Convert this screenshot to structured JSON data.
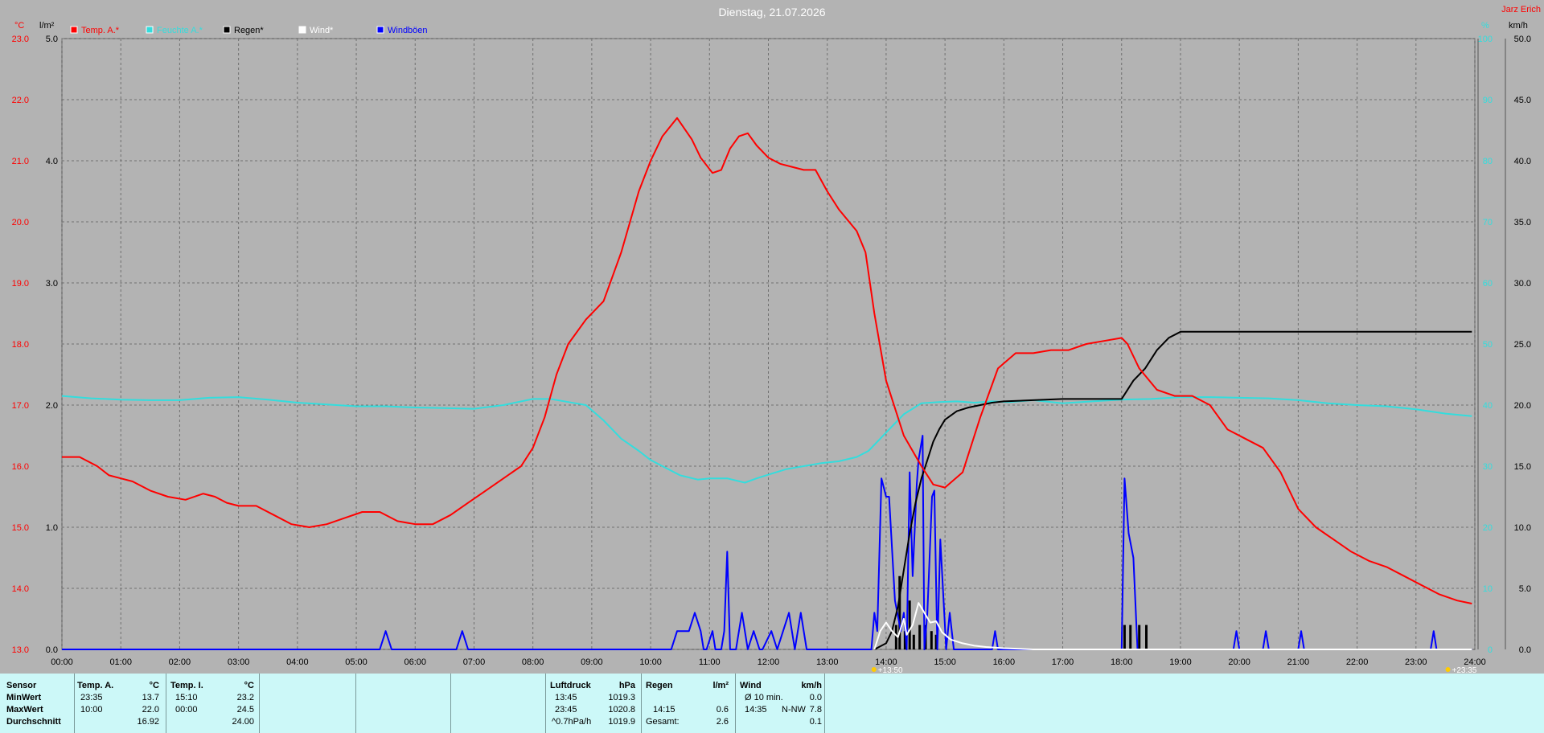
{
  "header": {
    "date": "Dienstag, 21.07.2026",
    "brand": "Jarz Erich"
  },
  "units": {
    "temp": "°C",
    "rain": "l/m²",
    "humidity": "%",
    "wind": "km/h"
  },
  "legend": [
    {
      "label": "Temp. A.*",
      "color": "#ff0000"
    },
    {
      "label": "Feuchte A.*",
      "color": "#33dddd"
    },
    {
      "label": "Regen*",
      "color": "#000000"
    },
    {
      "label": "Wind*",
      "color": "#ffffff"
    },
    {
      "label": "Windböen",
      "color": "#0000ff"
    }
  ],
  "time_markers": {
    "start": "13:50",
    "end": "23:35"
  },
  "chart_data": {
    "type": "line",
    "xlabel": "",
    "x_ticks": [
      "00:00",
      "01:00",
      "02:00",
      "03:00",
      "04:00",
      "05:00",
      "06:00",
      "07:00",
      "08:00",
      "09:00",
      "10:00",
      "11:00",
      "12:00",
      "13:00",
      "14:00",
      "15:00",
      "16:00",
      "17:00",
      "18:00",
      "19:00",
      "20:00",
      "21:00",
      "22:00",
      "23:00",
      "24:00"
    ],
    "xlim": [
      0,
      24
    ],
    "axes": {
      "temp": {
        "ylim": [
          13.0,
          23.0
        ],
        "ticks": [
          "13.0",
          "14.0",
          "15.0",
          "16.0",
          "17.0",
          "18.0",
          "19.0",
          "20.0",
          "21.0",
          "22.0",
          "23.0"
        ],
        "color": "#ff0000"
      },
      "rain": {
        "ylim": [
          0.0,
          5.0
        ],
        "ticks": [
          "0.0",
          "1.0",
          "2.0",
          "3.0",
          "4.0",
          "5.0"
        ],
        "color": "#000000"
      },
      "humidity": {
        "ylim": [
          0,
          100
        ],
        "ticks": [
          "0",
          "10",
          "20",
          "30",
          "40",
          "50",
          "60",
          "70",
          "80",
          "90",
          "100"
        ],
        "color": "#33dddd"
      },
      "wind": {
        "ylim": [
          0.0,
          50.0
        ],
        "ticks": [
          "0.0",
          "5.0",
          "10.0",
          "15.0",
          "20.0",
          "25.0",
          "30.0",
          "35.0",
          "40.0",
          "45.0",
          "50.0"
        ],
        "color": "#000000"
      }
    },
    "grid": true,
    "series": [
      {
        "name": "Temp. A.*",
        "axis": "temp",
        "color": "#ff0000",
        "x": [
          0,
          0.3,
          0.6,
          0.8,
          1.0,
          1.2,
          1.5,
          1.8,
          2.1,
          2.4,
          2.6,
          2.8,
          3.0,
          3.3,
          3.6,
          3.9,
          4.2,
          4.5,
          4.8,
          5.1,
          5.4,
          5.7,
          6.0,
          6.3,
          6.6,
          6.9,
          7.2,
          7.5,
          7.8,
          8.0,
          8.2,
          8.4,
          8.6,
          8.9,
          9.2,
          9.5,
          9.8,
          10.0,
          10.2,
          10.45,
          10.7,
          10.85,
          11.05,
          11.2,
          11.35,
          11.5,
          11.65,
          11.8,
          12.0,
          12.2,
          12.4,
          12.6,
          12.8,
          13.0,
          13.2,
          13.5,
          13.65,
          13.8,
          14.0,
          14.3,
          14.6,
          14.8,
          15.0,
          15.3,
          15.6,
          15.9,
          16.2,
          16.5,
          16.8,
          17.1,
          17.4,
          17.7,
          18.0,
          18.1,
          18.3,
          18.6,
          18.9,
          19.2,
          19.5,
          19.8,
          20.1,
          20.4,
          20.7,
          21.0,
          21.3,
          21.6,
          21.9,
          22.2,
          22.5,
          22.8,
          23.1,
          23.4,
          23.7,
          23.95
        ],
        "y": [
          16.15,
          16.15,
          16.0,
          15.85,
          15.8,
          15.75,
          15.6,
          15.5,
          15.45,
          15.55,
          15.5,
          15.4,
          15.35,
          15.35,
          15.2,
          15.05,
          15.0,
          15.05,
          15.15,
          15.25,
          15.25,
          15.1,
          15.05,
          15.05,
          15.2,
          15.4,
          15.6,
          15.8,
          16.0,
          16.3,
          16.8,
          17.5,
          18.0,
          18.4,
          18.7,
          19.5,
          20.5,
          21.0,
          21.4,
          21.7,
          21.35,
          21.05,
          20.8,
          20.85,
          21.2,
          21.4,
          21.45,
          21.25,
          21.05,
          20.95,
          20.9,
          20.85,
          20.85,
          20.5,
          20.2,
          19.85,
          19.5,
          18.5,
          17.4,
          16.5,
          16.0,
          15.7,
          15.65,
          15.9,
          16.8,
          17.6,
          17.85,
          17.85,
          17.9,
          17.9,
          18.0,
          18.05,
          18.1,
          18.0,
          17.6,
          17.25,
          17.15,
          17.15,
          17.0,
          16.6,
          16.45,
          16.3,
          15.9,
          15.3,
          15.0,
          14.8,
          14.6,
          14.45,
          14.35,
          14.2,
          14.05,
          13.9,
          13.8,
          13.75
        ]
      },
      {
        "name": "Feuchte A.*",
        "axis": "humidity",
        "color": "#33dddd",
        "x": [
          0,
          0.5,
          1.0,
          1.5,
          2.0,
          2.5,
          3.0,
          3.5,
          4.0,
          4.5,
          5.0,
          5.5,
          6.0,
          6.5,
          7.0,
          7.5,
          8.0,
          8.3,
          8.6,
          8.9,
          9.2,
          9.5,
          9.8,
          10.0,
          10.3,
          10.5,
          10.8,
          11.0,
          11.3,
          11.6,
          11.8,
          12.0,
          12.3,
          12.6,
          12.9,
          13.2,
          13.5,
          13.7,
          13.9,
          14.1,
          14.3,
          14.6,
          14.9,
          15.2,
          15.5,
          15.8,
          16.1,
          16.5,
          17.0,
          17.5,
          18.0,
          18.5,
          19.0,
          19.5,
          20.0,
          20.5,
          21.0,
          21.5,
          22.0,
          22.5,
          23.0,
          23.5,
          23.95
        ],
        "y": [
          41.5,
          41.1,
          40.9,
          40.8,
          40.8,
          41.2,
          41.3,
          40.9,
          40.4,
          40.1,
          39.8,
          39.8,
          39.6,
          39.5,
          39.4,
          40,
          41,
          41,
          40.5,
          40.0,
          37.5,
          34.5,
          32.5,
          31.0,
          29.5,
          28.5,
          27.8,
          28.0,
          28.0,
          27.3,
          28.0,
          28.6,
          29.5,
          30.0,
          30.5,
          30.8,
          31.5,
          32.5,
          34.5,
          36.5,
          38.5,
          40.3,
          40.5,
          40.6,
          40.4,
          40.6,
          40.5,
          40.8,
          40.3,
          40.6,
          40.9,
          41.0,
          41.3,
          41.3,
          41.2,
          41.1,
          40.8,
          40.3,
          40.0,
          39.8,
          39.3,
          38.6,
          38.2
        ]
      },
      {
        "name": "Regen*",
        "axis": "rain",
        "color": "#000000",
        "x": [
          13.8,
          14.0,
          14.1,
          14.2,
          14.3,
          14.4,
          14.5,
          14.6,
          14.7,
          14.8,
          14.9,
          15.0,
          15.2,
          15.4,
          15.6,
          15.8,
          16.0,
          16.5,
          17.0,
          17.5,
          18.0,
          18.2,
          18.4,
          18.6,
          18.8,
          19.0,
          19.2,
          19.5,
          20.0,
          21.0,
          22.0,
          23.0,
          23.95
        ],
        "y": [
          0.0,
          0.05,
          0.15,
          0.35,
          0.65,
          0.95,
          1.2,
          1.4,
          1.55,
          1.7,
          1.8,
          1.88,
          1.95,
          1.98,
          2.0,
          2.02,
          2.03,
          2.04,
          2.05,
          2.05,
          2.05,
          2.2,
          2.3,
          2.45,
          2.55,
          2.6,
          2.6,
          2.6,
          2.6,
          2.6,
          2.6,
          2.6,
          2.6
        ]
      },
      {
        "name": "Wind*",
        "axis": "wind",
        "color": "#ffffff",
        "x": [
          13.8,
          13.9,
          14.0,
          14.1,
          14.2,
          14.3,
          14.35,
          14.45,
          14.55,
          14.65,
          14.75,
          14.85,
          14.95,
          15.1,
          15.3,
          15.5,
          15.7,
          16.0,
          16.5,
          17.0,
          17.5,
          18.0,
          18.5,
          19.0,
          19.5,
          20.0,
          21.0,
          22.0,
          23.0,
          23.95
        ],
        "y": [
          0,
          1.5,
          2.2,
          1.5,
          1.0,
          2.5,
          1.2,
          2.0,
          3.8,
          3.0,
          2.2,
          2.3,
          1.4,
          0.8,
          0.5,
          0.3,
          0.2,
          0.1,
          0,
          0,
          0,
          0,
          0,
          0,
          0,
          0,
          0,
          0,
          0,
          0
        ]
      },
      {
        "name": "Windböen",
        "axis": "wind",
        "color": "#0000ff",
        "x": [
          0,
          5.4,
          5.5,
          5.6,
          6.7,
          6.8,
          6.9,
          10.35,
          10.45,
          10.55,
          10.65,
          10.75,
          10.85,
          10.9,
          10.95,
          11.05,
          11.1,
          11.2,
          11.25,
          11.3,
          11.35,
          11.45,
          11.55,
          11.65,
          11.75,
          11.85,
          11.9,
          12.05,
          12.15,
          12.25,
          12.35,
          12.45,
          12.55,
          12.65,
          13.75,
          13.8,
          13.85,
          13.92,
          14.0,
          14.05,
          14.15,
          14.25,
          14.3,
          14.35,
          14.4,
          14.45,
          14.52,
          14.55,
          14.62,
          14.65,
          14.7,
          14.78,
          14.82,
          14.87,
          14.92,
          15.02,
          15.08,
          15.15,
          15.8,
          15.85,
          15.9,
          18.0,
          18.05,
          18.12,
          18.2,
          18.27,
          18.35,
          19.9,
          19.95,
          20.0,
          20.4,
          20.45,
          20.5,
          21.0,
          21.05,
          21.1,
          23.25,
          23.3,
          23.35,
          23.95
        ],
        "y": [
          0,
          0,
          1.5,
          0,
          0,
          1.5,
          0,
          0,
          1.5,
          1.5,
          1.5,
          3.0,
          1.5,
          0,
          0,
          1.5,
          0,
          0,
          1.5,
          8.0,
          0,
          0,
          3.0,
          0,
          1.5,
          0,
          0,
          1.5,
          0,
          1.5,
          3.0,
          0,
          3.0,
          0,
          0,
          3.0,
          1.5,
          14.0,
          12.5,
          12.5,
          4.0,
          1.5,
          3.0,
          0,
          14.5,
          6.0,
          13.5,
          15.5,
          17.5,
          0,
          3.0,
          12.5,
          13.0,
          0,
          9.0,
          0,
          3.0,
          0,
          0,
          1.5,
          0,
          0,
          14.0,
          9.5,
          7.5,
          0,
          0,
          0,
          1.5,
          0,
          0,
          1.5,
          0,
          0,
          1.5,
          0,
          0,
          1.5,
          0,
          0
        ]
      }
    ],
    "rain_bars": [
      {
        "x": 14.17,
        "y": 2.0
      },
      {
        "x": 14.23,
        "y": 6.0
      },
      {
        "x": 14.32,
        "y": 1.5
      },
      {
        "x": 14.4,
        "y": 4.0
      },
      {
        "x": 14.47,
        "y": 1.2
      },
      {
        "x": 14.57,
        "y": 2.0
      },
      {
        "x": 14.67,
        "y": 2.0
      },
      {
        "x": 14.77,
        "y": 1.5
      },
      {
        "x": 14.85,
        "y": 1.2
      },
      {
        "x": 18.05,
        "y": 2.0
      },
      {
        "x": 18.15,
        "y": 2.0
      },
      {
        "x": 18.3,
        "y": 2.0
      },
      {
        "x": 18.42,
        "y": 2.0
      }
    ]
  },
  "panel": {
    "sensor": {
      "label": "Sensor",
      "minwert": "MinWert",
      "maxwert": "MaxWert",
      "avg": "Durchschnitt"
    },
    "temp_a": {
      "title": "Temp. A.",
      "unit": "°C",
      "min_time": "23:35",
      "min_val": "13.7",
      "max_time": "10:00",
      "max_val": "22.0",
      "avg": "16.92"
    },
    "temp_i": {
      "title": "Temp. I.",
      "unit": "°C",
      "min_time": "15:10",
      "min_val": "23.2",
      "max_time": "00:00",
      "max_val": "24.5",
      "avg": "24.00"
    },
    "pressure": {
      "title": "Luftdruck",
      "unit": "hPa",
      "min_time": "13:45",
      "min_val": "1019.3",
      "max_time": "23:45",
      "max_val": "1020.8",
      "trend": "^0.7hPa/h",
      "current": "1019.9"
    },
    "rain": {
      "title": "Regen",
      "unit": "l/m²",
      "max_time": "14:15",
      "max_val": "0.6",
      "total_label": "Gesamt:",
      "total": "2.6"
    },
    "wind": {
      "title": "Wind",
      "unit": "km/h",
      "avg_label": "Ø 10 min.",
      "avg_val": "0.0",
      "max_time": "14:35",
      "max_dir": "N-NW",
      "max_val": "7.8",
      "avg": "0.1"
    }
  }
}
